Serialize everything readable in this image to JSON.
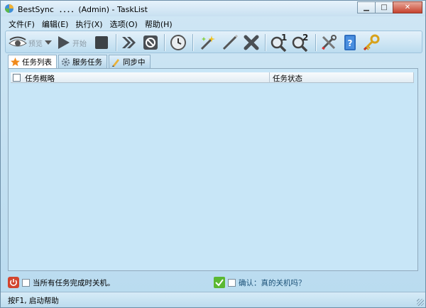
{
  "window": {
    "title": "BestSync  ．．．．(Admin) - TaskList",
    "minimize_glyph": "▁",
    "maximize_glyph": "□",
    "close_glyph": "✕"
  },
  "menu": {
    "items": [
      "文件(F)",
      "编辑(E)",
      "执行(X)",
      "选项(O)",
      "帮助(H)"
    ]
  },
  "toolbar": {
    "preview_label": "预览",
    "start_label": "开始",
    "find1_label": "1",
    "find2_label": "2"
  },
  "tabs": [
    {
      "label": "任务列表",
      "icon": "star-icon",
      "active": true
    },
    {
      "label": "服务任务",
      "icon": "gear-icon",
      "active": false
    },
    {
      "label": "同步中",
      "icon": "pencil-icon",
      "active": false
    }
  ],
  "list": {
    "columns": [
      "任务概略",
      "任务状态"
    ],
    "rows": []
  },
  "options": {
    "shutdown_label": "当所有任务完成时关机。",
    "confirm_label": "确认：真的关机吗？"
  },
  "status": {
    "text": "按F1, 启动帮助"
  },
  "colors": {
    "panel_bg": "#c8e6f7",
    "title_bg": "#cfe6f4",
    "close_btn": "#c7422e"
  }
}
